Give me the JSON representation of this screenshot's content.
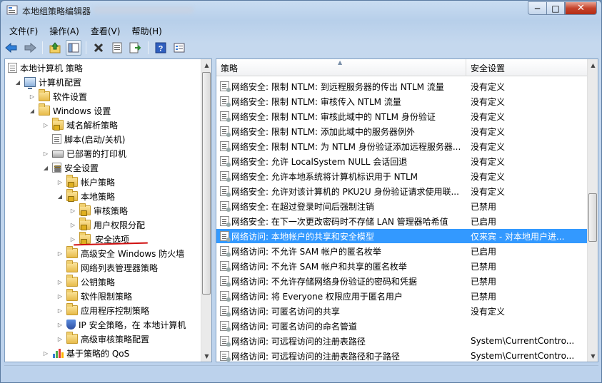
{
  "window": {
    "title": "本地组策略编辑器",
    "min_label": "─",
    "max_label": "□",
    "close_label": "✕"
  },
  "menu": [
    "文件(F)",
    "操作(A)",
    "查看(V)",
    "帮助(H)"
  ],
  "toolbar": [
    "back-icon",
    "forward-icon",
    "up-icon",
    "show-hide-tree-icon",
    "delete-icon",
    "properties-icon",
    "export-icon",
    "help-icon",
    "view-icon"
  ],
  "tree": [
    {
      "label": "本地计算机 策略",
      "icon": "policy-icon",
      "arrow": "",
      "level": 0
    },
    {
      "label": "计算机配置",
      "icon": "computer-icon",
      "arrow": "expanded",
      "level": 1
    },
    {
      "label": "软件设置",
      "icon": "folder-icon",
      "arrow": "collapsed",
      "level": 2
    },
    {
      "label": "Windows 设置",
      "icon": "folder-icon",
      "arrow": "expanded",
      "level": 2
    },
    {
      "label": "域名解析策略",
      "icon": "folder-lock-icon",
      "arrow": "collapsed",
      "level": 3
    },
    {
      "label": "脚本(启动/关机)",
      "icon": "script-icon",
      "arrow": "",
      "level": 3
    },
    {
      "label": "已部署的打印机",
      "icon": "printer-icon",
      "arrow": "collapsed",
      "level": 3
    },
    {
      "label": "安全设置",
      "icon": "security-settings-icon",
      "arrow": "expanded",
      "level": 3
    },
    {
      "label": "帐户策略",
      "icon": "folder-lock-icon",
      "arrow": "collapsed",
      "level": 4
    },
    {
      "label": "本地策略",
      "icon": "folder-lock-icon",
      "arrow": "expanded",
      "level": 4
    },
    {
      "label": "审核策略",
      "icon": "folder-lock-icon",
      "arrow": "collapsed",
      "level": 5
    },
    {
      "label": "用户权限分配",
      "icon": "folder-lock-icon",
      "arrow": "collapsed",
      "level": 5
    },
    {
      "label": "安全选项",
      "icon": "folder-lock-icon",
      "arrow": "collapsed",
      "level": 5,
      "selected": true
    },
    {
      "label": "高级安全 Windows 防火墙",
      "icon": "folder-icon",
      "arrow": "collapsed",
      "level": 4
    },
    {
      "label": "网络列表管理器策略",
      "icon": "folder-icon",
      "arrow": "",
      "level": 4
    },
    {
      "label": "公钥策略",
      "icon": "folder-icon",
      "arrow": "collapsed",
      "level": 4
    },
    {
      "label": "软件限制策略",
      "icon": "folder-icon",
      "arrow": "collapsed",
      "level": 4
    },
    {
      "label": "应用程序控制策略",
      "icon": "folder-icon",
      "arrow": "collapsed",
      "level": 4
    },
    {
      "label": "IP 安全策略，在 本地计算机",
      "icon": "ip-security-icon",
      "arrow": "collapsed",
      "level": 4
    },
    {
      "label": "高级审核策略配置",
      "icon": "folder-icon",
      "arrow": "collapsed",
      "level": 4
    },
    {
      "label": "基于策略的 QoS",
      "icon": "qos-chart-icon",
      "arrow": "collapsed",
      "level": 3
    }
  ],
  "columns": {
    "policy": "策略",
    "setting": "安全设置"
  },
  "rows": [
    {
      "name": "网络安全: 限制 NTLM: 到远程服务器的传出 NTLM 流量",
      "value": "没有定义"
    },
    {
      "name": "网络安全: 限制 NTLM: 审核传入 NTLM 流量",
      "value": "没有定义"
    },
    {
      "name": "网络安全: 限制 NTLM: 审核此域中的 NTLM 身份验证",
      "value": "没有定义"
    },
    {
      "name": "网络安全: 限制 NTLM: 添加此域中的服务器例外",
      "value": "没有定义"
    },
    {
      "name": "网络安全: 限制 NTLM: 为 NTLM 身份验证添加远程服务器...",
      "value": "没有定义"
    },
    {
      "name": "网络安全: 允许 LocalSystem NULL 会话回退",
      "value": "没有定义"
    },
    {
      "name": "网络安全: 允许本地系统将计算机标识用于 NTLM",
      "value": "没有定义"
    },
    {
      "name": "网络安全: 允许对该计算机的 PKU2U 身份验证请求使用联...",
      "value": "没有定义"
    },
    {
      "name": "网络安全: 在超过登录时间后强制注销",
      "value": "已禁用"
    },
    {
      "name": "网络安全: 在下一次更改密码时不存储 LAN 管理器哈希值",
      "value": "已启用"
    },
    {
      "name": "网络访问: 本地帐户的共享和安全模型",
      "value": "仅来宾 - 对本地用户进...",
      "selected": true
    },
    {
      "name": "网络访问: 不允许 SAM 帐户的匿名枚举",
      "value": "已启用"
    },
    {
      "name": "网络访问: 不允许 SAM 帐户和共享的匿名枚举",
      "value": "已禁用"
    },
    {
      "name": "网络访问: 不允许存储网络身份验证的密码和凭据",
      "value": "已禁用"
    },
    {
      "name": "网络访问: 将 Everyone 权限应用于匿名用户",
      "value": "已禁用"
    },
    {
      "name": "网络访问: 可匿名访问的共享",
      "value": "没有定义"
    },
    {
      "name": "网络访问: 可匿名访问的命名管道",
      "value": ""
    },
    {
      "name": "网络访问: 可远程访问的注册表路径",
      "value": "System\\CurrentContro..."
    },
    {
      "name": "网络访问: 可远程访问的注册表路径和子路径",
      "value": "System\\CurrentContro..."
    }
  ],
  "colors": {
    "selection": "#3399ff",
    "annotation_underline": "#d01010"
  }
}
